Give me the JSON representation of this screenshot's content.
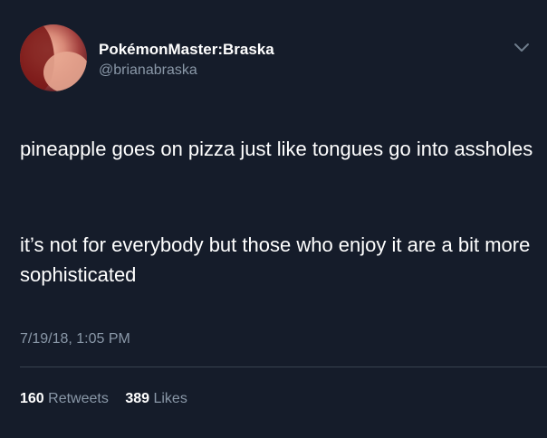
{
  "author": {
    "display_name": "PokémonMaster:Braska",
    "handle": "@brianabraska"
  },
  "icons": {
    "menu": "chevron-down-icon"
  },
  "tweet": {
    "paragraphs": [
      "pineapple goes on pizza just like tongues go into assholes",
      "it’s not for everybody but those who enjoy it are a bit more sophisticated"
    ],
    "timestamp": "7/19/18, 1:05 PM"
  },
  "stats": {
    "retweets_count": "160",
    "retweets_label": "Retweets",
    "likes_count": "389",
    "likes_label": "Likes"
  },
  "colors": {
    "background": "#151c2a",
    "primary_text": "#ffffff",
    "secondary_text": "#8a98a8",
    "divider": "#38424f"
  }
}
